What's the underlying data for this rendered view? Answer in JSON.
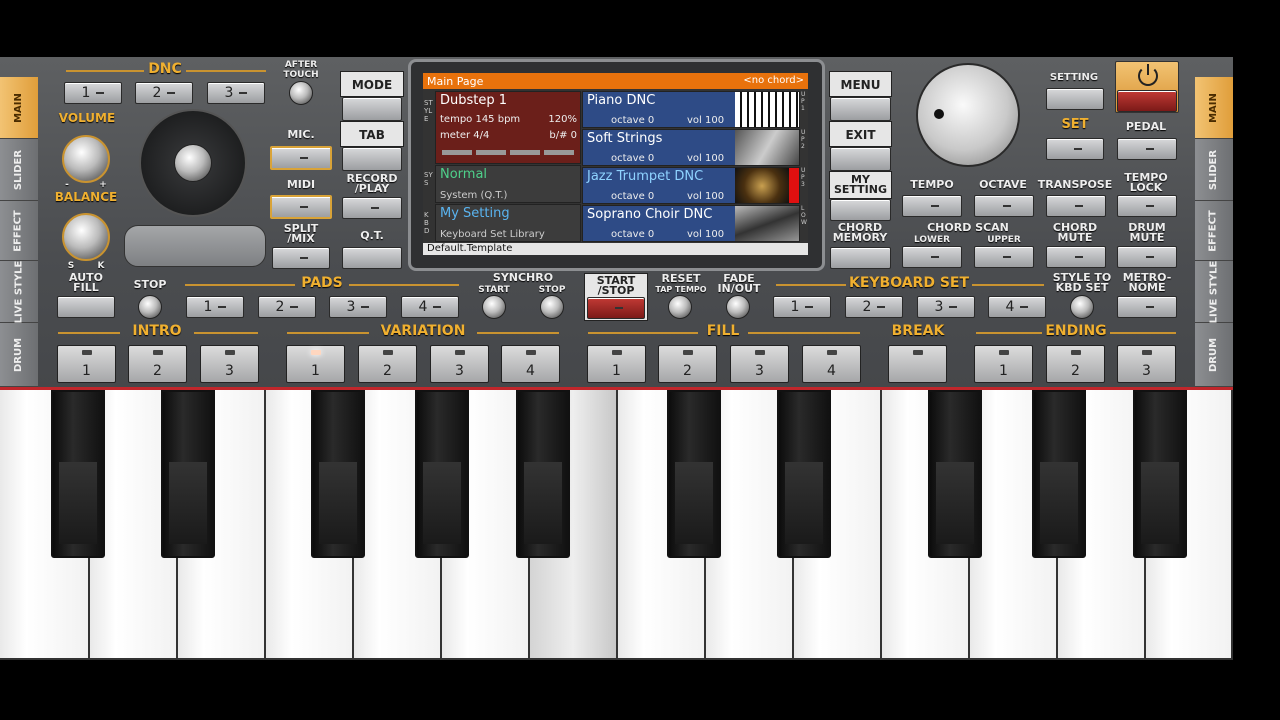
{
  "dnc": {
    "title": "DNC",
    "buttons": [
      "1",
      "2",
      "3"
    ],
    "after_touch": "AFTER TOUCH"
  },
  "knobs": {
    "volume": "VOLUME",
    "balance": "BALANCE",
    "balance_marks": [
      "S",
      "K"
    ],
    "volume_marks": [
      "-",
      "+"
    ]
  },
  "left_buttons": {
    "mic": "MIC.",
    "midi": "MIDI",
    "split": "SPLIT /MIX"
  },
  "mid_buttons": {
    "mode": "MODE",
    "tab": "TAB",
    "record": "RECORD /PLAY",
    "qt": "Q.T."
  },
  "screen": {
    "header": "Main Page",
    "chord": "<no chord>",
    "style_side": "STYLE",
    "sys_side": "SYS",
    "kbd_side": "KBD",
    "style": {
      "name": "Dubstep 1",
      "tempo": "tempo 145 bpm",
      "percent": "120%",
      "meter": "meter 4/4",
      "bsharp": "b/# 0"
    },
    "system": {
      "name": "Normal",
      "sub": "System (Q.T.)"
    },
    "setting": {
      "name": "My Setting",
      "sub": "Keyboard Set Library"
    },
    "voices": [
      {
        "name": "Piano DNC",
        "octave": "octave 0",
        "vol": "vol 100",
        "slot": "UP1"
      },
      {
        "name": "Soft Strings",
        "octave": "octave 0",
        "vol": "vol 100",
        "slot": "UP2"
      },
      {
        "name": "Jazz Trumpet DNC",
        "octave": "octave 0",
        "vol": "vol 100",
        "slot": "UP3"
      },
      {
        "name": "Soprano Choir DNC",
        "octave": "octave 0",
        "vol": "vol 100",
        "slot": "LOW"
      }
    ],
    "footer": "Default.Template"
  },
  "right_buttons": {
    "menu": "MENU",
    "exit": "EXIT",
    "my_setting": "MY SETTING",
    "chord_memory": "CHORD MEMORY"
  },
  "top_right": {
    "setting": "SETTING",
    "set": "SET",
    "pedal": "PEDAL",
    "tempo": "TEMPO",
    "octave": "OCTAVE",
    "transpose": "TRANSPOSE",
    "tempo_lock": "TEMPO LOCK",
    "chord_scan": "CHORD SCAN",
    "lower": "LOWER",
    "upper": "UPPER",
    "chord_mute": "CHORD MUTE",
    "drum_mute": "DRUM MUTE"
  },
  "row3": {
    "auto_fill": "AUTO FILL",
    "stop": "STOP",
    "pads": "PADS",
    "pad_buttons": [
      "1",
      "2",
      "3",
      "4"
    ],
    "synchro": "SYNCHRO",
    "start": "START",
    "stop2": "STOP",
    "start_stop": "START /STOP",
    "reset": "RESET",
    "tap_tempo": "TAP TEMPO",
    "fade": "FADE IN/OUT",
    "keyboard_set": "KEYBOARD SET",
    "kbd_buttons": [
      "1",
      "2",
      "3",
      "4"
    ],
    "style_to_kbd": "STYLE TO KBD SET",
    "metronome": "METRO- NOME"
  },
  "row4": {
    "intro": "INTRO",
    "intro_pads": [
      "1",
      "2",
      "3"
    ],
    "variation": "VARIATION",
    "variation_pads": [
      "1",
      "2",
      "3",
      "4"
    ],
    "fill": "FILL",
    "fill_pads": [
      "1",
      "2",
      "3",
      "4"
    ],
    "break": "BREAK",
    "ending": "ENDING",
    "ending_pads": [
      "1",
      "2",
      "3"
    ]
  },
  "left_tabs": [
    "MAIN",
    "SLIDER",
    "EFFECT",
    "LIVE STYLE",
    "DRUM"
  ],
  "right_tabs": [
    "MAIN",
    "SLIDER",
    "EFFECT",
    "LIVE STYLE",
    "DRUM"
  ],
  "colors": {
    "accent": "#f0b030",
    "screen_header": "#e8720c",
    "style_cell": "#6b1f1a",
    "voice_cell": "#2e4b86",
    "system_cell": "#3a3a3a",
    "highlight": "#d9a338"
  }
}
